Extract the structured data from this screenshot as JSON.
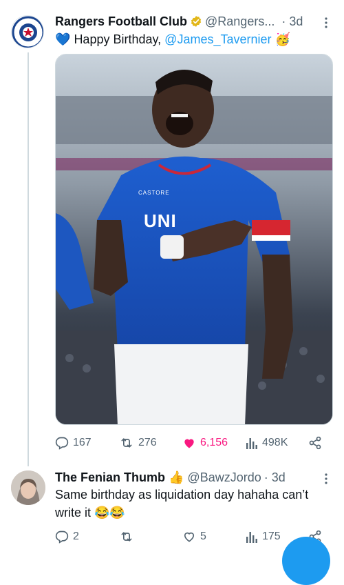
{
  "tweet": {
    "author_name": "Rangers Football Club",
    "author_handle": "@Rangers...",
    "time": "· 3d",
    "text_lead": "Happy Birthday, ",
    "mention": "@James_Tavernier",
    "emoji_heart": "💙",
    "emoji_party": "🥳",
    "avatar_ring_text": "RANGERS FOOTBALL CLUB",
    "stats": {
      "replies": "167",
      "retweets": "276",
      "likes": "6,156",
      "views": "498K"
    },
    "media": {
      "shirt_sponsor": "UNI",
      "kit_brand": "CASTORE"
    }
  },
  "reply": {
    "author_name": "The Fenian Thumb",
    "emoji_thumb": "👍",
    "author_handle": "@BawzJordo",
    "time": "· 3d",
    "text": "Same birthday as liquidation day hahaha can’t write it 😂😂",
    "stats": {
      "replies": "2",
      "retweets": "",
      "likes": "5",
      "views": "175"
    }
  },
  "colors": {
    "accent": "#1d9bf0",
    "like": "#f91880",
    "muted": "#536471",
    "verified_gold": "#e2b719"
  }
}
